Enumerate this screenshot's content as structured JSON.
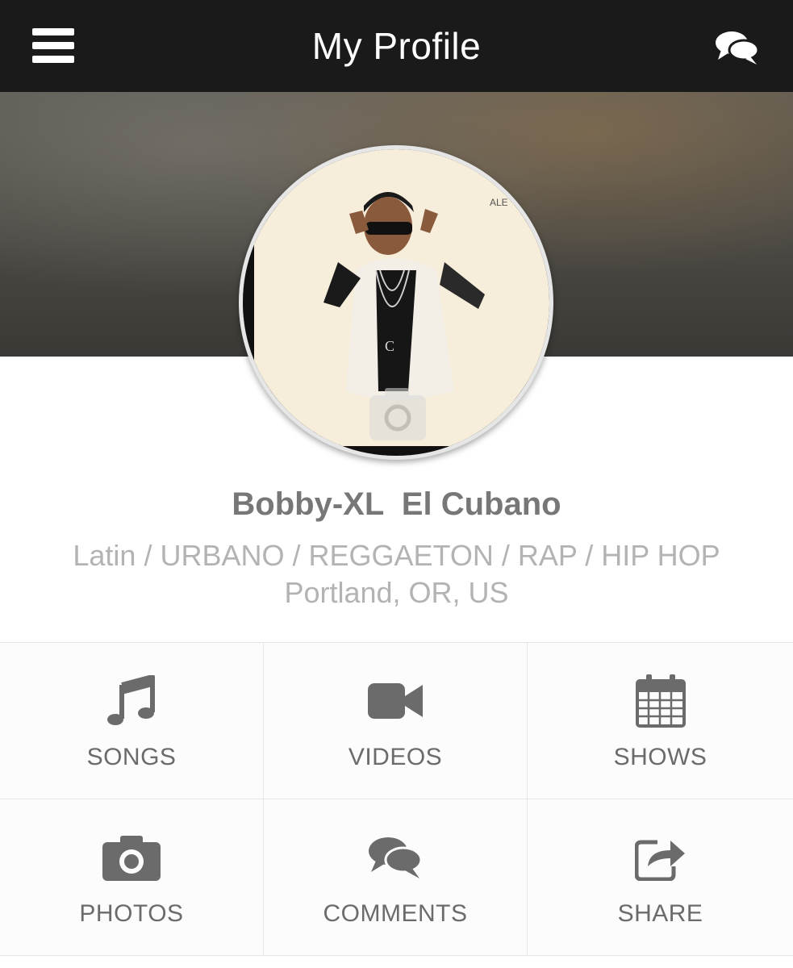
{
  "header": {
    "title": "My Profile",
    "menu_icon": "hamburger-menu-icon",
    "chat_icon": "chat-bubbles-icon",
    "background": "#1a1a1a"
  },
  "profile": {
    "name": "Bobby-XL  El Cubano",
    "genres": "Latin / URBANO / REGGAETON / RAP / HIP HOP",
    "location": "Portland, OR, US",
    "avatar_overlay_icon": "camera-icon"
  },
  "menu": [
    {
      "label": "SONGS",
      "icon": "music-note-icon"
    },
    {
      "label": "VIDEOS",
      "icon": "video-camera-icon"
    },
    {
      "label": "SHOWS",
      "icon": "calendar-icon"
    },
    {
      "label": "PHOTOS",
      "icon": "camera-icon"
    },
    {
      "label": "COMMENTS",
      "icon": "comments-icon"
    },
    {
      "label": "SHARE",
      "icon": "share-icon"
    }
  ],
  "colors": {
    "icon_gray": "#6b6b6b",
    "name_gray": "#777777",
    "sub_gray": "#b3b3b3"
  }
}
